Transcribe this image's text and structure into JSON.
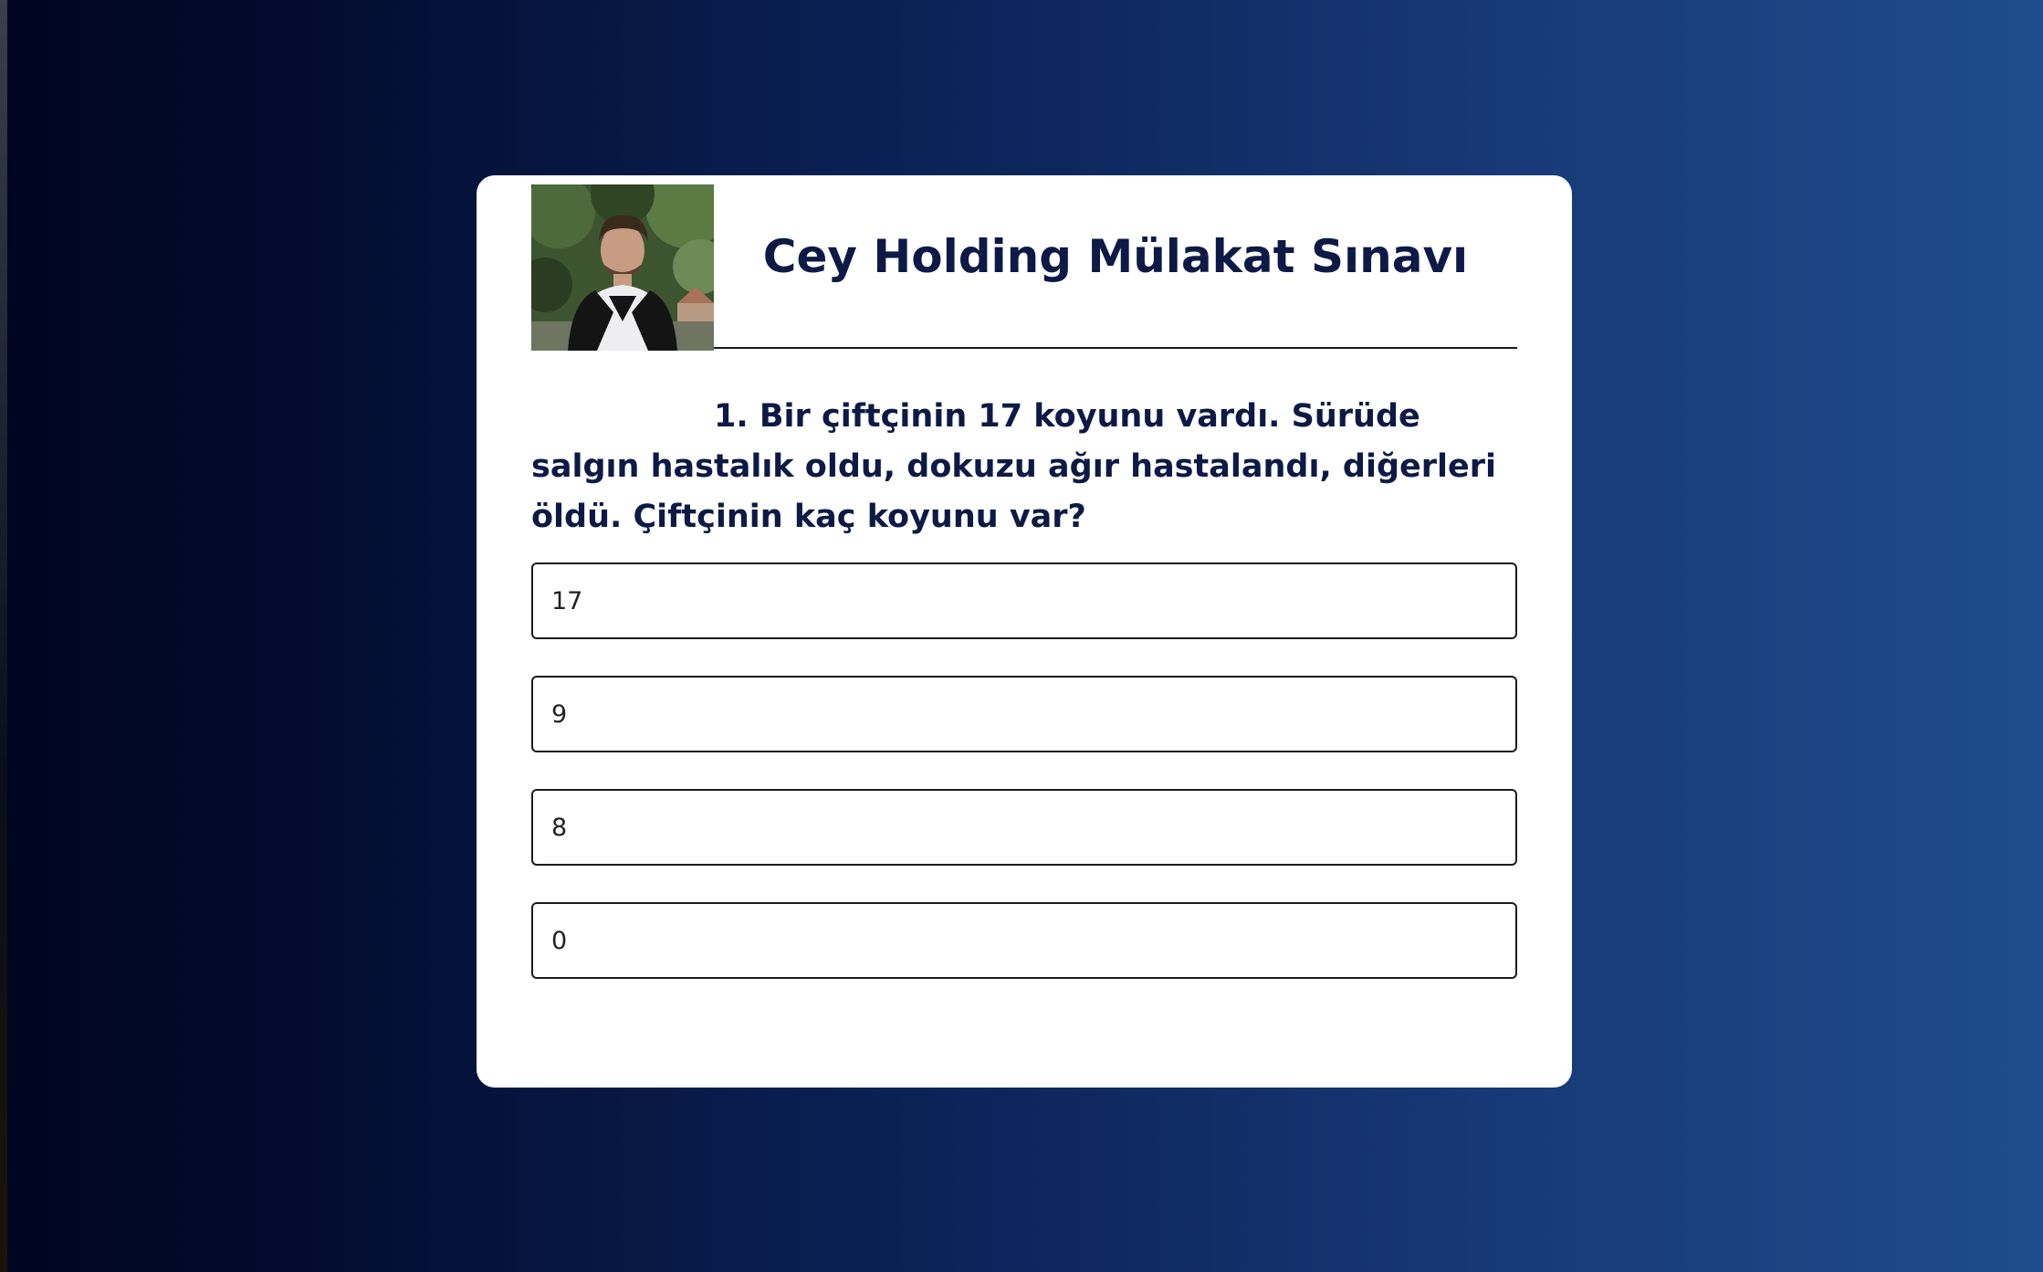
{
  "header": {
    "title": "Cey Holding Mülakat Sınavı"
  },
  "question": {
    "text": "1. Bir çiftçinin 17 koyunu vardı. Sürüde salgın hastalık oldu, dokuzu ağır hastalandı, diğerleri öldü. Çiftçinin kaç koyunu var?"
  },
  "options": [
    {
      "label": "17"
    },
    {
      "label": "9"
    },
    {
      "label": "8"
    },
    {
      "label": "0"
    }
  ],
  "colors": {
    "title": "#0c1a45",
    "card": "#ffffff",
    "background_left": "#000520",
    "background_right": "#1f4c8c"
  }
}
